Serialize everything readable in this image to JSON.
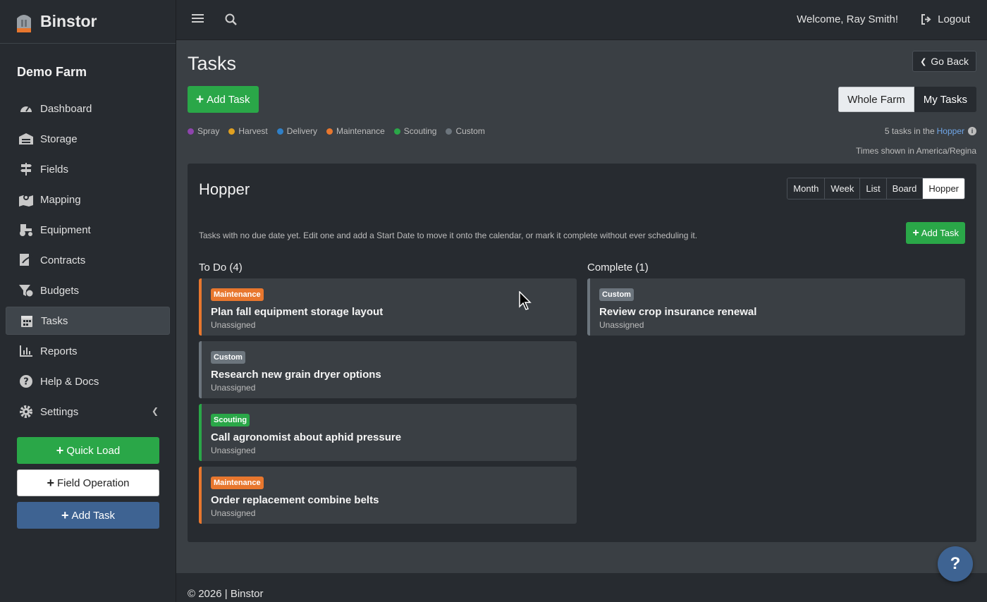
{
  "brand": {
    "name": "Binstor"
  },
  "sidebar": {
    "farm_name": "Demo Farm",
    "items": [
      {
        "label": "Dashboard",
        "icon": "gauge-icon"
      },
      {
        "label": "Storage",
        "icon": "warehouse-icon"
      },
      {
        "label": "Fields",
        "icon": "signpost-icon"
      },
      {
        "label": "Mapping",
        "icon": "map-pin-icon"
      },
      {
        "label": "Equipment",
        "icon": "tractor-icon"
      },
      {
        "label": "Contracts",
        "icon": "signature-icon"
      },
      {
        "label": "Budgets",
        "icon": "funnel-dollar-icon"
      },
      {
        "label": "Tasks",
        "icon": "calendar-icon",
        "active": true
      },
      {
        "label": "Reports",
        "icon": "chart-icon"
      },
      {
        "label": "Help & Docs",
        "icon": "question-circle-icon"
      },
      {
        "label": "Settings",
        "icon": "gear-icon"
      }
    ],
    "buttons": {
      "quick_load": "Quick Load",
      "field_operation": "Field Operation",
      "add_task": "Add Task"
    }
  },
  "topbar": {
    "welcome": "Welcome, Ray Smith!",
    "logout": "Logout"
  },
  "page": {
    "title": "Tasks",
    "go_back": "Go Back",
    "add_task": "Add Task",
    "scope_toggle": {
      "whole_farm": "Whole Farm",
      "my_tasks": "My Tasks",
      "selected": "Whole Farm"
    },
    "legend": [
      {
        "label": "Spray",
        "color": "#8e44ad"
      },
      {
        "label": "Harvest",
        "color": "#e0a020"
      },
      {
        "label": "Delivery",
        "color": "#2f80c8"
      },
      {
        "label": "Maintenance",
        "color": "#e8772e"
      },
      {
        "label": "Scouting",
        "color": "#2aa748"
      },
      {
        "label": "Custom",
        "color": "#6c757d"
      }
    ],
    "count_prefix": "5 tasks in the",
    "count_link": "Hopper",
    "timezone": "Times shown in America/Regina"
  },
  "card": {
    "title": "Hopper",
    "views": [
      "Month",
      "Week",
      "List",
      "Board",
      "Hopper"
    ],
    "active_view": "Hopper",
    "description": "Tasks with no due date yet. Edit one and add a Start Date to move it onto the calendar, or mark it complete without ever scheduling it.",
    "add_task": "Add Task",
    "todo": {
      "heading": "To Do (4)",
      "tasks": [
        {
          "category": "Maintenance",
          "title": "Plan fall equipment storage layout",
          "assignee": "Unassigned"
        },
        {
          "category": "Custom",
          "title": "Research new grain dryer options",
          "assignee": "Unassigned"
        },
        {
          "category": "Scouting",
          "title": "Call agronomist about aphid pressure",
          "assignee": "Unassigned"
        },
        {
          "category": "Maintenance",
          "title": "Order replacement combine belts",
          "assignee": "Unassigned"
        }
      ]
    },
    "complete": {
      "heading": "Complete (1)",
      "tasks": [
        {
          "category": "Custom",
          "title": "Review crop insurance renewal",
          "assignee": "Unassigned"
        }
      ]
    }
  },
  "footer": {
    "text": "© 2026 | Binstor"
  },
  "help_button": "?",
  "colors": {
    "accent_green": "#2aa748",
    "accent_blue": "#3e6392",
    "maintenance": "#e8772e",
    "custom": "#6c757d",
    "scouting": "#2aa748",
    "link": "#6fa6e8"
  }
}
